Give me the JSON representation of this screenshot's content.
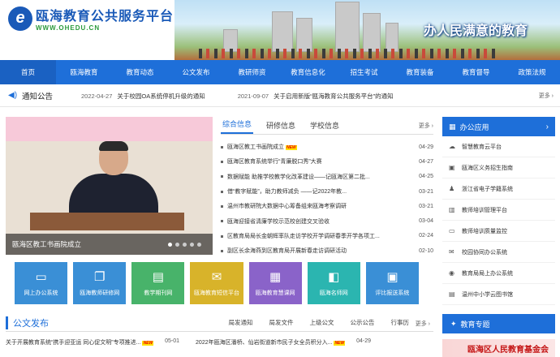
{
  "header": {
    "logo_mark": "e",
    "title": "瓯海教育公共服务平台",
    "url": "WWW.OHEDU.CN",
    "slogan": "办人民满意的教育"
  },
  "nav": {
    "items": [
      "首页",
      "瓯海教育",
      "教育动态",
      "公文发布",
      "教研师资",
      "教育信息化",
      "招生考试",
      "教育装备",
      "教育督导",
      "政策法规"
    ]
  },
  "notice": {
    "title": "通知公告",
    "items": [
      {
        "date": "2022-04-27",
        "text": "关于校园OA系统停机升级的通知"
      },
      {
        "date": "2021-09-07",
        "text": "关于启用新版“瓯海教育公共服务平台”的通知"
      }
    ],
    "more": "更多"
  },
  "slideshow": {
    "caption": "瓯海区教工书画院成立",
    "dots": 5,
    "active_dot": 1
  },
  "news": {
    "tabs": [
      "综合信息",
      "研修信息",
      "学校信息"
    ],
    "more": "更多",
    "rows": [
      {
        "title": "瓯海区教工书画院成立",
        "date": "04-29",
        "new": true
      },
      {
        "title": "瓯海区教育系统举行“青廉脱口秀”大赛",
        "date": "04-27",
        "new": false
      },
      {
        "title": "数据赋能 助推学校教学化改革建设——记瓯海区第二批...",
        "date": "04-25",
        "new": false
      },
      {
        "title": "借“教字赋能”，助力教师减负 ——记2022年教...",
        "date": "03-21",
        "new": false
      },
      {
        "title": "温州市教研院大数据中心筹备组来瓯海考察调研",
        "date": "03-21",
        "new": false
      },
      {
        "title": "瓯海迎接省清廉学校示范校创建交叉验收",
        "date": "03-04",
        "new": false
      },
      {
        "title": "区教育局局长金朝辉率队走访学校开学调研春季开学各项工...",
        "date": "02-24",
        "new": false
      },
      {
        "title": "副区长余海燕到区教育局开展新春走访调研活动",
        "date": "02-10",
        "new": false
      }
    ]
  },
  "apps": {
    "title": "办公应用",
    "items": [
      {
        "label": "智慧教育云平台",
        "icon": "cloud-icon"
      },
      {
        "label": "瓯海区义务招生指南",
        "icon": "book-icon"
      },
      {
        "label": "浙江省电子学籍系统",
        "icon": "user-icon"
      },
      {
        "label": "教师培训管理平台",
        "icon": "chart-icon"
      },
      {
        "label": "教师培训质量监控",
        "icon": "monitor-icon"
      },
      {
        "label": "校园协同办公系统",
        "icon": "mail-icon"
      },
      {
        "label": "教育局局上办公系统",
        "icon": "chat-icon"
      },
      {
        "label": "温州中小学云图书馆",
        "icon": "library-icon"
      }
    ]
  },
  "tiles": [
    {
      "label": "网上办公系统",
      "color": "#3a8fd6",
      "icon": "▭"
    },
    {
      "label": "瓯海教师研修网",
      "color": "#3a8fd6",
      "icon": "❐"
    },
    {
      "label": "教学期刊网",
      "color": "#48b36a",
      "icon": "▤"
    },
    {
      "label": "瓯海教育短信平台",
      "color": "#d8b32a",
      "icon": "✉"
    },
    {
      "label": "瓯海教育慧课网",
      "color": "#8a63c9",
      "icon": "▦"
    },
    {
      "label": "瓯海名师网",
      "color": "#2bb5b0",
      "icon": "◧"
    },
    {
      "label": "评比报送系统",
      "color": "#3a8fd6",
      "icon": "▣"
    }
  ],
  "docs": {
    "title": "公文发布",
    "tabs": [
      "局发通知",
      "局发文件",
      "上级公文",
      "公示公告",
      "行事历"
    ],
    "more": "更多",
    "rows": [
      {
        "text": "关于开展教育系统“携手迎亚运 同心促文明”专项推进...",
        "date": "05-01",
        "new": true
      },
      {
        "text": "2022年瓯海区潘桥、仙岩街道新市民子女全员积分入...",
        "date": "04-29",
        "new": true
      }
    ]
  },
  "special": {
    "title": "教育专题",
    "banner": "瓯海区人民教育基金会"
  }
}
